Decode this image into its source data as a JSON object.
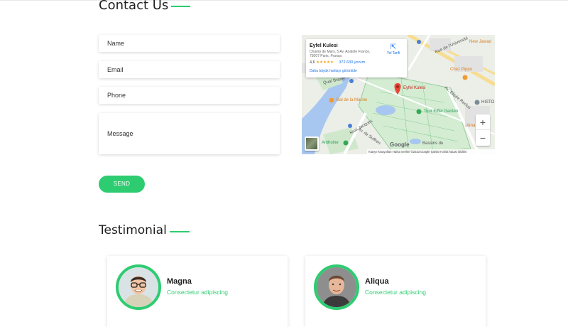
{
  "contact": {
    "title": "Contact Us",
    "fields": {
      "name": "Name",
      "email": "Email",
      "phone": "Phone",
      "message": "Message"
    },
    "send_label": "SEND"
  },
  "map": {
    "card": {
      "place_name": "Eyfel Kulesi",
      "address": "Champ de Mars, 5 Av. Anatole France, 75007 Paris, Fransa",
      "rating": "4,6",
      "stars": "★★★★★",
      "reviews": "372.630 yorum",
      "larger_map_link": "Daha büyük haritayı görüntüle",
      "directions_label": "Yol Tarifi"
    },
    "labels": {
      "rue_universite": "Rue de l'Université",
      "new_jawad": "New Jawad",
      "chez_pippo": "Chez Pippo",
      "eyfel": "Eyfel Kulesi",
      "bal": "Bal de la Marine",
      "tour_eiffel_garden": "Tour Eiffel Garden",
      "histo": "HISTO",
      "ama": "Ama",
      "anthoine": "Anthoine",
      "av_suffren": "Av. de Suffren",
      "av_elisee": "Av. Elisée Reclus",
      "bassins": "Bassins du",
      "quai": "Quai Branly",
      "kuai": "Kuai Jacques"
    },
    "zoom_in": "+",
    "zoom_out": "−",
    "google_logo": "Google",
    "attribution": "Klavye kısayolları   Harita verileri ©2023 Google   Şartlar   Harita hatası bildirin",
    "accent_color": "#2ecc71"
  },
  "testimonial": {
    "title": "Testimonial",
    "items": [
      {
        "name": "Magna",
        "subtitle": "Consectetur adipiscing"
      },
      {
        "name": "Aliqua",
        "subtitle": "Consectetur adipiscing"
      }
    ]
  }
}
